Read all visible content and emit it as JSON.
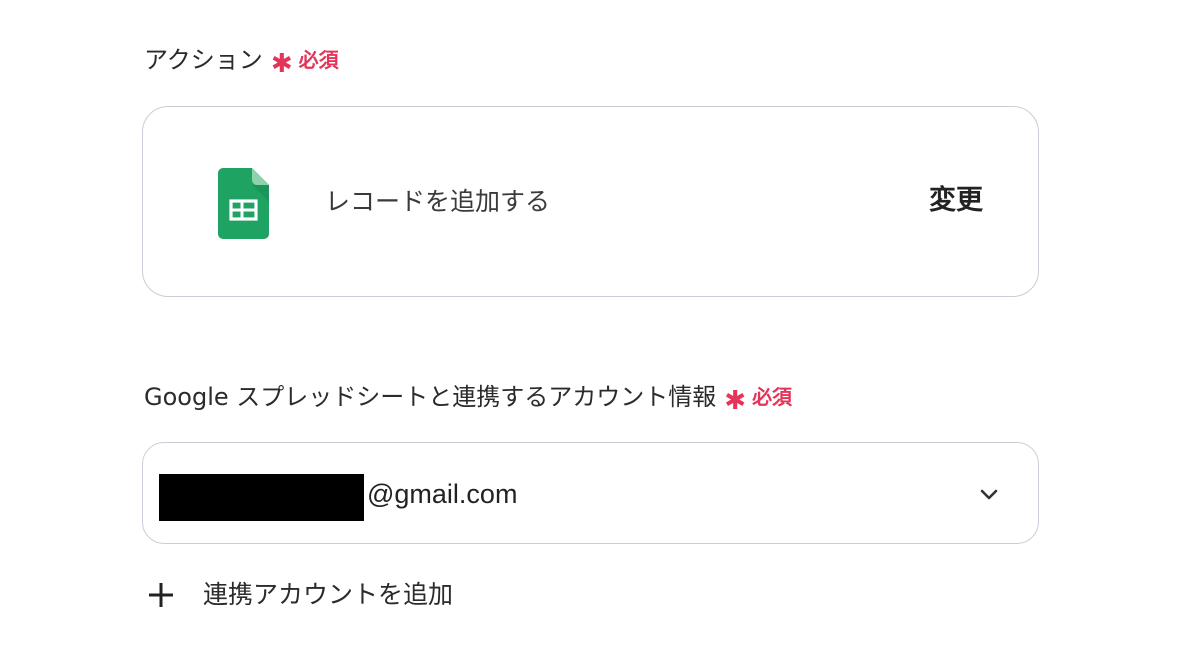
{
  "action_section": {
    "label": "アクション",
    "required_mark": "✱",
    "required_text": "必須",
    "action_name": "レコードを追加する",
    "app_icon": "google-sheets-icon",
    "change_label": "変更"
  },
  "account_section": {
    "label": "Google スプレッドシートと連携するアカウント情報",
    "required_mark": "✱",
    "required_text": "必須",
    "selected_account": "@gmail.com",
    "dropdown_icon": "chevron-down-icon",
    "add_account_icon": "plus-icon",
    "add_account_label": "連携アカウントを追加"
  },
  "colors": {
    "required": "#e5345a",
    "sheets_green": "#1ea362",
    "border": "#c9cdd6",
    "text": "#2b2b2b"
  }
}
